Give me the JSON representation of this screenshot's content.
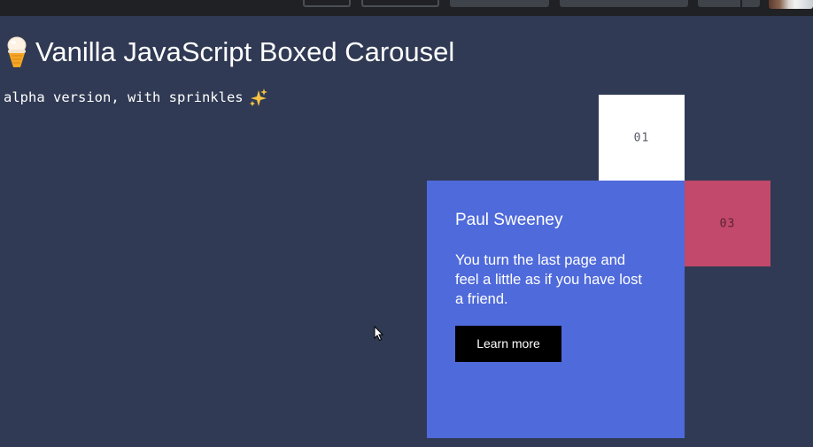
{
  "header": {
    "title": "Vanilla JavaScript Boxed Carousel",
    "title_icon": "ice-cream-icon",
    "subtitle": "alpha version, with sprinkles",
    "subtitle_icon": "sparkles-icon"
  },
  "carousel": {
    "boxes": [
      {
        "number": "01",
        "color": "#ffffff"
      },
      {
        "number": "03",
        "color": "#c2496b"
      }
    ],
    "active": {
      "name": "Paul Sweeney",
      "quote": "You turn the last page and feel a little as if you have lost a friend.",
      "button_label": "Learn more",
      "color": "#4f6adb"
    }
  },
  "colors": {
    "background": "#303a54",
    "topbar": "#1f2124"
  }
}
